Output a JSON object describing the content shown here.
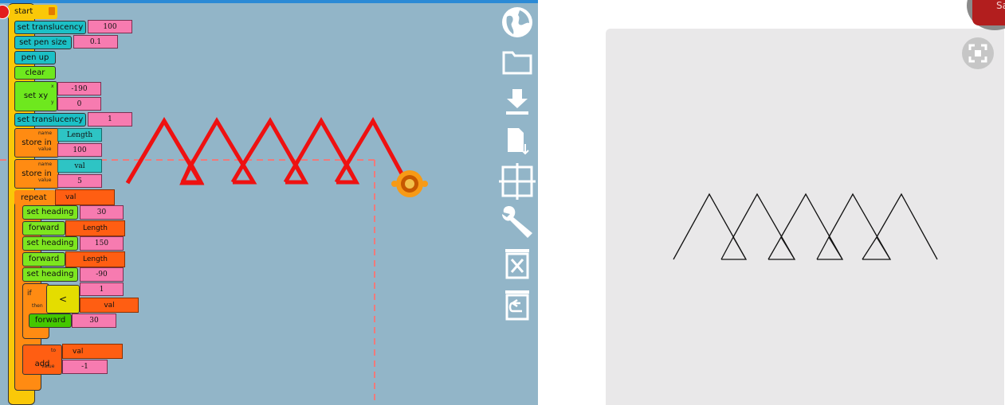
{
  "blocks": {
    "start": "start",
    "set_translucency": "set translucency",
    "translucency_value": "100",
    "set_pen_size": "set pen size",
    "pen_size_value": "0.1",
    "pen_up": "pen up",
    "clear": "clear",
    "set_xy": "set xy",
    "x_label": "x",
    "y_label": "y",
    "x_value": "-190",
    "y_value": "0",
    "set_translucency_2": "set translucency",
    "translucency_value_2": "1",
    "store_in_1": "store in",
    "name_label": "name",
    "value_label": "value",
    "store1_name": "Length",
    "store1_value": "100",
    "store_in_2": "store in",
    "store2_name": "val",
    "store2_value": "5",
    "repeat": "repeat",
    "repeat_value": "val",
    "set_heading_1": "set heading",
    "heading_value_1": "30",
    "forward_1": "forward",
    "forward_value_1": "Length",
    "set_heading_2": "set heading",
    "heading_value_2": "150",
    "forward_2": "forward",
    "forward_value_2": "Length",
    "set_heading_3": "set heading",
    "heading_value_3": "-90",
    "if": "if",
    "then": "then",
    "less_than": "<",
    "compare_left": "1",
    "compare_right": "val",
    "forward_3": "forward",
    "forward_value_3": "30",
    "add": "add",
    "to_label": "to",
    "add_to": "val",
    "add_value": "-1"
  },
  "palette": {
    "icons": [
      "globe-icon",
      "folder-icon",
      "download-icon",
      "save-file-icon",
      "grid-icon",
      "wrench-icon",
      "trash-icon",
      "restore-trash-icon"
    ]
  },
  "right_panel": {
    "corner_button_text": "Sa"
  },
  "colors": {
    "workspace_bg": "#92b5c8",
    "turtle_line": "#ee1111",
    "output_bg": "#e9e8e9",
    "output_line": "#111111"
  }
}
